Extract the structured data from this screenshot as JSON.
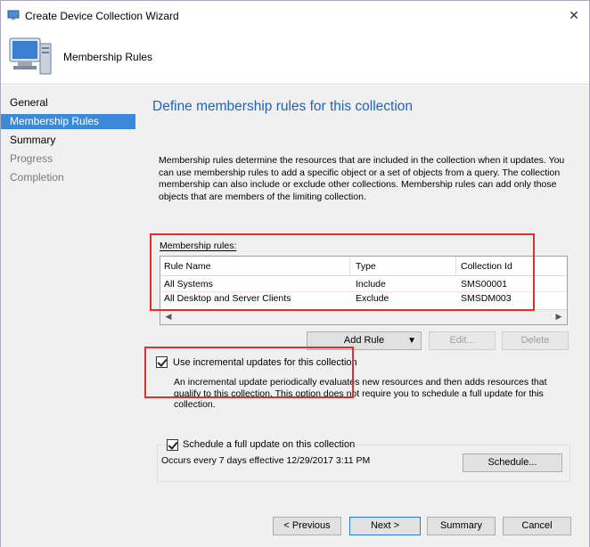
{
  "window": {
    "title": "Create Device Collection Wizard",
    "close_glyph": "✕"
  },
  "header": {
    "title": "Membership Rules"
  },
  "nav": {
    "items": [
      {
        "label": "General",
        "state": "normal"
      },
      {
        "label": "Membership Rules",
        "state": "active"
      },
      {
        "label": "Summary",
        "state": "normal"
      },
      {
        "label": "Progress",
        "state": "disabled"
      },
      {
        "label": "Completion",
        "state": "disabled"
      }
    ]
  },
  "main": {
    "heading": "Define membership rules for this collection",
    "description": "Membership rules determine the resources that are included in the collection when it updates. You can use membership rules to add a specific object or a set of objects from a query. The collection membership can also include or exclude other collections. Membership rules can add only those objects that are members of the limiting collection.",
    "rules_label": "Membership rules:",
    "table": {
      "columns": [
        "Rule Name",
        "Type",
        "Collection Id"
      ],
      "rows": [
        [
          "All Systems",
          "Include",
          "SMS00001"
        ],
        [
          "All Desktop and Server Clients",
          "Exclude",
          "SMSDM003"
        ]
      ]
    },
    "buttons": {
      "add_rule": "Add Rule",
      "edit": "Edit...",
      "delete": "Delete"
    },
    "incremental": {
      "checked": true,
      "label": "Use incremental updates for this collection",
      "info": "An incremental update periodically evaluates new resources and then adds resources that qualify to this collection. This option does not require you to schedule a full update for this collection."
    },
    "schedule": {
      "checked": true,
      "label": "Schedule a full update on this collection",
      "occurs": "Occurs every 7 days effective 12/29/2017 3:11 PM",
      "button": "Schedule..."
    }
  },
  "footer": {
    "previous": "< Previous",
    "next": "Next >",
    "summary": "Summary",
    "cancel": "Cancel"
  },
  "colors": {
    "accent": "#3b8ad8",
    "heading": "#1e63b5",
    "highlight_box": "#e0302e"
  }
}
